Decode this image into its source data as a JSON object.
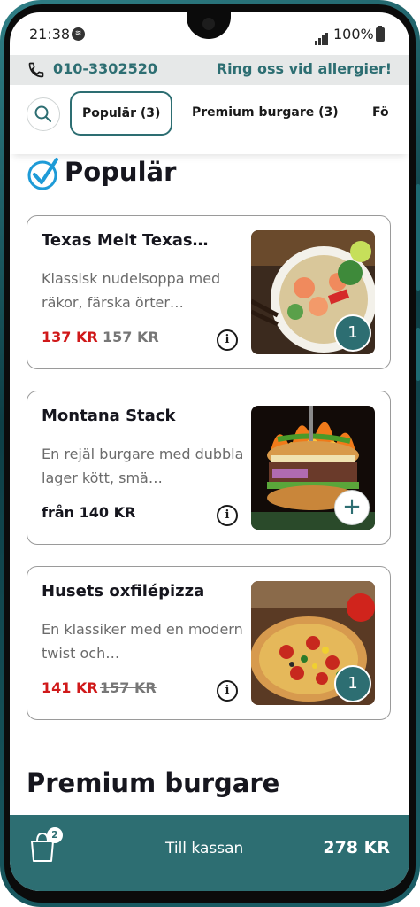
{
  "status_bar": {
    "time": "21:38",
    "battery": "100%"
  },
  "info_bar": {
    "phone": "010-3302520",
    "notice": "Ring oss vid allergier!"
  },
  "tabs": [
    {
      "label": "Populär (3)",
      "active": true
    },
    {
      "label": "Premium burgare (3)",
      "active": false
    },
    {
      "label": "Fö",
      "active": false
    }
  ],
  "sections": {
    "popular_title": "Populär",
    "premium_title": "Premium burgare"
  },
  "products": [
    {
      "name": "Texas Melt Texas…",
      "description": "Klassisk nudelsoppa med räkor, färska örter…",
      "price": "137 KR",
      "old_price": "157 KR",
      "quantity": "1",
      "image": "noodle-soup"
    },
    {
      "name": "Montana Stack",
      "description": "En rejäl burgare med dubbla lager kött, smä…",
      "price": "från 140 KR",
      "old_price": "",
      "quantity": "",
      "image": "burger"
    },
    {
      "name": "Husets oxfilépizza",
      "description": "En klassiker med en modern twist och…",
      "price": "141 KR",
      "old_price": "157 KR",
      "quantity": "1",
      "image": "pizza"
    }
  ],
  "checkout": {
    "bag_count": "2",
    "label": "Till kassan",
    "total": "278 KR"
  },
  "colors": {
    "accent": "#2d6e72",
    "sale_price": "#d0191a",
    "brand_check": "#1e9bd7"
  }
}
